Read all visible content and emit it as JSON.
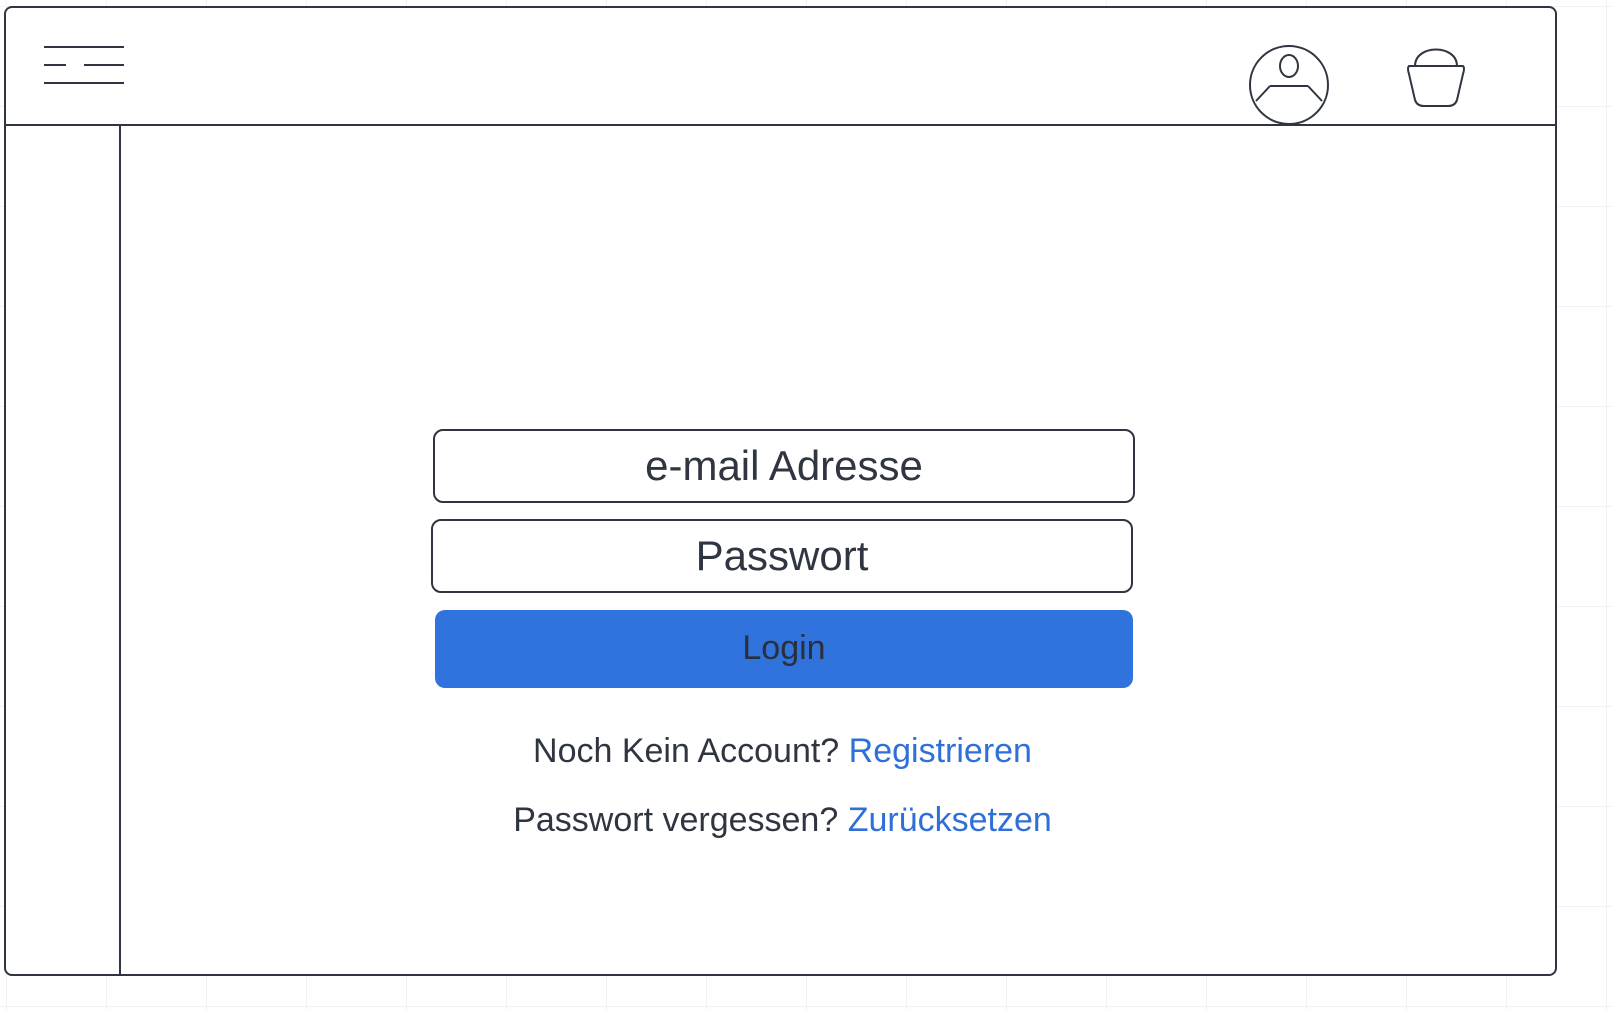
{
  "header": {
    "menu_icon": "hamburger-menu-icon",
    "user_icon": "user-account-icon",
    "basket_icon": "shopping-basket-icon"
  },
  "login": {
    "email_placeholder": "e-mail Adresse",
    "password_placeholder": "Passwort",
    "login_label": "Login",
    "register_prompt": "Noch Kein Account?",
    "register_link": "Registrieren",
    "reset_prompt": "Passwort vergessen?",
    "reset_link": "Zurücksetzen"
  },
  "colors": {
    "accent": "#3073dd",
    "link": "#2f6fd8",
    "outline": "#2f3541",
    "text": "#2f3541"
  }
}
